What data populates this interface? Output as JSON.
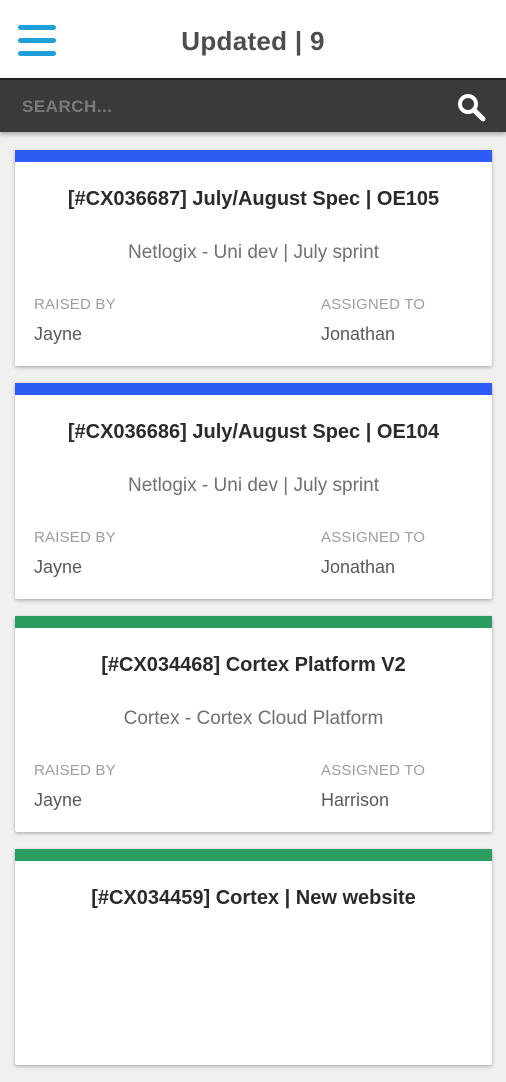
{
  "header": {
    "menu_icon": "hamburger-menu-icon",
    "title": "Updated | 9"
  },
  "search": {
    "placeholder": "SEARCH...",
    "value": "",
    "icon": "search-icon"
  },
  "labels": {
    "raised_by": "RAISED BY",
    "assigned_to": "ASSIGNED TO"
  },
  "colors": {
    "menu_icon": "#1f9fd8",
    "stripe_blue": "#2f5bf5",
    "stripe_green": "#2a9c60",
    "search_bar": "#3a3a3a"
  },
  "tickets": [
    {
      "stripe": "blue",
      "title": "[#CX036687] July/August Spec | OE105",
      "subtitle": "Netlogix - Uni dev | July sprint",
      "raised_by": "Jayne",
      "assigned_to": "Jonathan"
    },
    {
      "stripe": "blue",
      "title": "[#CX036686] July/August Spec | OE104",
      "subtitle": "Netlogix - Uni dev | July sprint",
      "raised_by": "Jayne",
      "assigned_to": "Jonathan"
    },
    {
      "stripe": "green",
      "title": "[#CX034468] Cortex Platform V2",
      "subtitle": "Cortex - Cortex Cloud Platform",
      "raised_by": "Jayne",
      "assigned_to": "Harrison"
    },
    {
      "stripe": "green",
      "title": "[#CX034459] Cortex | New website",
      "subtitle": "",
      "raised_by": "",
      "assigned_to": ""
    }
  ]
}
